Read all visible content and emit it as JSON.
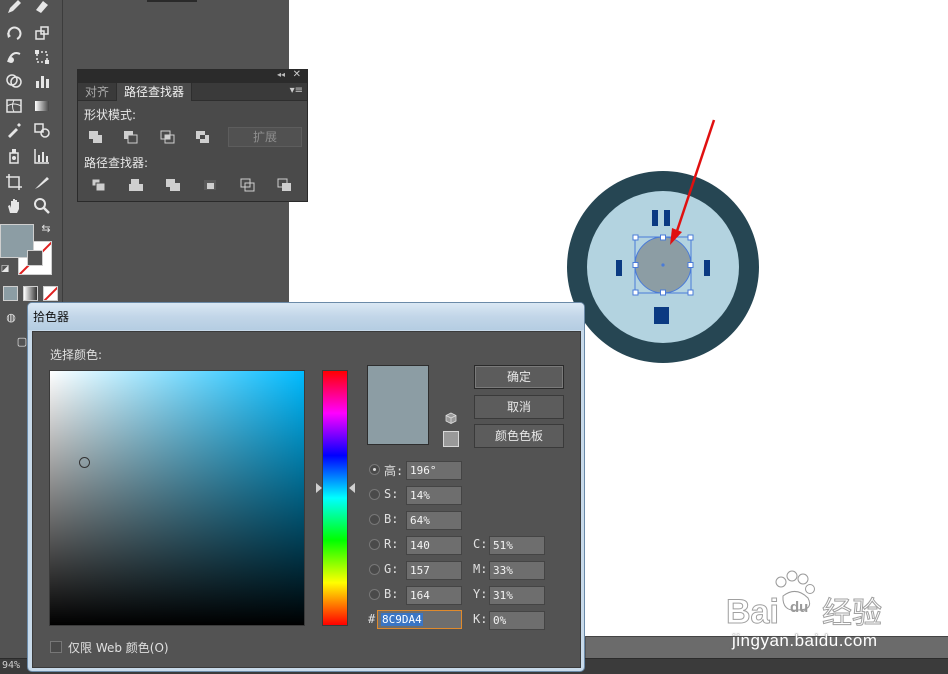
{
  "status": {
    "zoom": "94%"
  },
  "toolbar": {
    "tools": [
      "pencil-tool",
      "eraser-tool",
      "rotate-tool",
      "scale-tool",
      "warp-tool",
      "free-transform-tool",
      "shape-builder-tool",
      "graph-tool",
      "mesh-tool",
      "gradient-tool",
      "eyedropper-tool",
      "blend-tool",
      "symbol-sprayer-tool",
      "column-graph-tool",
      "artboard-tool",
      "slice-tool",
      "hand-tool",
      "zoom-tool"
    ],
    "fill_color": "#8c9da4",
    "stroke": "none"
  },
  "pathfinder": {
    "tabs": [
      {
        "label": "对齐",
        "active": false
      },
      {
        "label": "路径查找器",
        "active": true
      }
    ],
    "shape_modes_label": "形状模式:",
    "shape_modes": [
      "unite-icon",
      "minus-front-icon",
      "intersect-icon",
      "exclude-icon"
    ],
    "expand_label": "扩展",
    "pathfinders_label": "路径查找器:",
    "pathfinders": [
      "divide-icon",
      "trim-icon",
      "merge-icon",
      "crop-icon",
      "outline-icon",
      "minus-back-icon"
    ]
  },
  "canvas": {
    "outer_ring_color": "#264653",
    "inner_circle_color": "#b3d3e0",
    "center_circle_color": "#8c9da4",
    "marker_color": "#0b3a82",
    "arrow_color": "#e01010"
  },
  "color_picker": {
    "title": "拾色器",
    "select_label": "选择颜色:",
    "ok_label": "确定",
    "cancel_label": "取消",
    "swatches_label": "颜色色板",
    "current_color": "#8c9da4",
    "websafe_color": "#999999",
    "hsb": [
      {
        "label": "高:",
        "value": "196°",
        "selected": true
      },
      {
        "label": "S:",
        "value": "14%",
        "selected": false
      },
      {
        "label": "B:",
        "value": "64%",
        "selected": false
      }
    ],
    "rgb": [
      {
        "label": "R:",
        "value": "140"
      },
      {
        "label": "G:",
        "value": "157"
      },
      {
        "label": "B:",
        "value": "164"
      }
    ],
    "cmyk": [
      {
        "label": "C:",
        "value": "51%"
      },
      {
        "label": "M:",
        "value": "33%"
      },
      {
        "label": "Y:",
        "value": "31%"
      },
      {
        "label": "K:",
        "value": "0%"
      }
    ],
    "hex_label": "#",
    "hex_value": "8C9DA4",
    "web_only_label": "仅限 Web 颜色(O)"
  },
  "watermark": {
    "brand": "Baidu经验",
    "url": "jingyan.baidu.com"
  }
}
